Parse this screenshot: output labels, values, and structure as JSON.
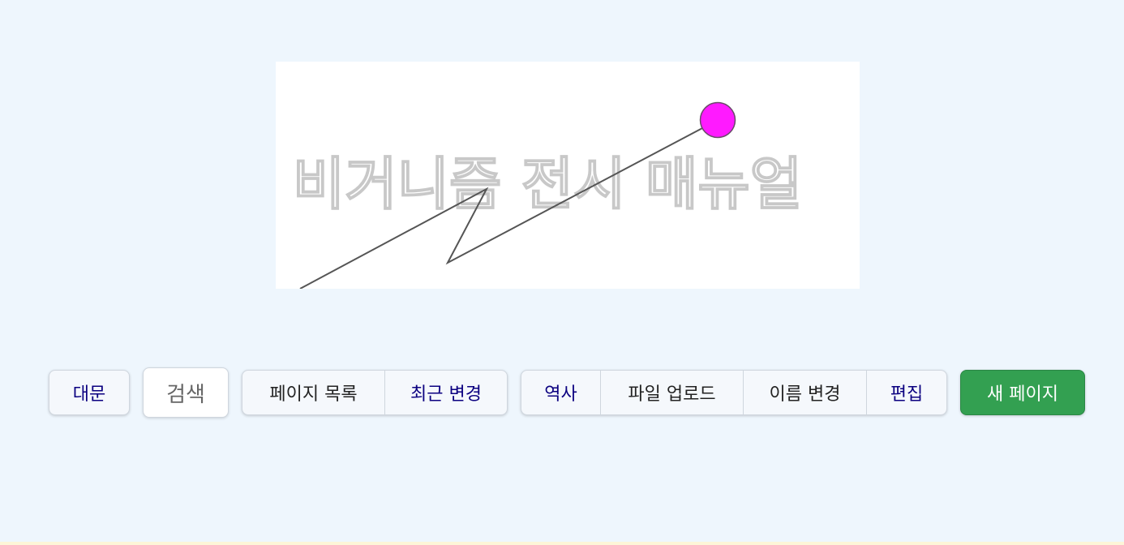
{
  "logo": {
    "text": "비거니즘 전시 매뉴얼",
    "dot_color": "#ff1aff",
    "line_color": "#555555"
  },
  "nav": {
    "main_page": "대문",
    "search": "검색",
    "page_list": "페이지 목록",
    "recent_changes": "최근 변경",
    "history": "역사",
    "file_upload": "파일 업로드",
    "rename": "이름 변경",
    "edit": "편집",
    "new_page": "새 페이지"
  },
  "colors": {
    "background": "#eef6fd",
    "link": "#0b0080",
    "new_page_button": "#33a051"
  }
}
